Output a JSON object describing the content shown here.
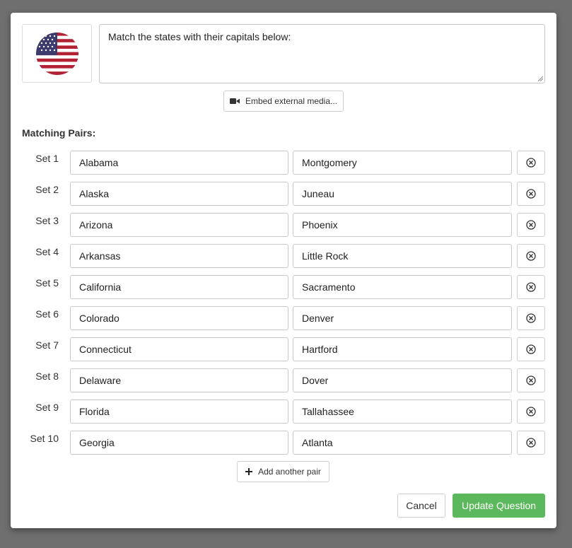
{
  "question": {
    "image_icon": "us-flag-icon",
    "prompt_text": "Match the states with their capitals below:",
    "embed_label": "Embed external media..."
  },
  "section_label": "Matching Pairs:",
  "pairs": [
    {
      "label": "Set 1",
      "left": "Alabama",
      "right": "Montgomery"
    },
    {
      "label": "Set 2",
      "left": "Alaska",
      "right": "Juneau"
    },
    {
      "label": "Set 3",
      "left": "Arizona",
      "right": "Phoenix"
    },
    {
      "label": "Set 4",
      "left": "Arkansas",
      "right": "Little Rock"
    },
    {
      "label": "Set 5",
      "left": "California",
      "right": "Sacramento"
    },
    {
      "label": "Set 6",
      "left": "Colorado",
      "right": "Denver"
    },
    {
      "label": "Set 7",
      "left": "Connecticut",
      "right": "Hartford"
    },
    {
      "label": "Set 8",
      "left": "Delaware",
      "right": "Dover"
    },
    {
      "label": "Set 9",
      "left": "Florida",
      "right": "Tallahassee"
    },
    {
      "label": "Set 10",
      "left": "Georgia",
      "right": "Atlanta"
    }
  ],
  "actions": {
    "add_pair_label": "Add another pair",
    "cancel_label": "Cancel",
    "update_label": "Update Question"
  },
  "colors": {
    "primary_green": "#5cb85c",
    "backdrop": "#6f6f6f"
  }
}
